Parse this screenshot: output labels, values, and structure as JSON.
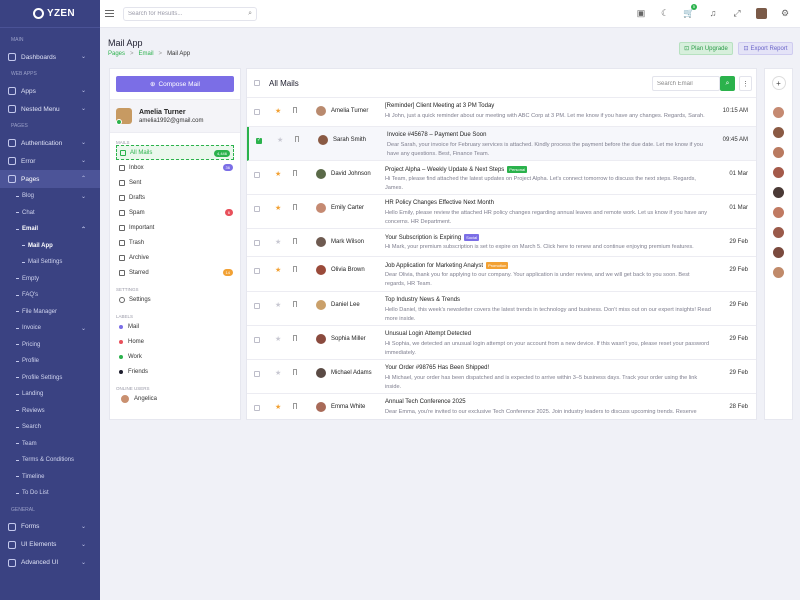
{
  "brand": {
    "name": "YZEN"
  },
  "sidebar": {
    "sections": {
      "main": "MAIN",
      "webapps": "WEB APPS",
      "pages": "PAGES",
      "general": "GENERAL"
    },
    "items": {
      "dashboards": "Dashboards",
      "apps": "Apps",
      "nested_menu": "Nested Menu",
      "authentication": "Authentication",
      "error": "Error",
      "pages": "Pages",
      "blog": "Blog",
      "chat": "Chat",
      "email": "Email",
      "mail_app": "Mail App",
      "mail_settings": "Mail Settings",
      "empty": "Empty",
      "faqs": "FAQ's",
      "file_manager": "File Manager",
      "invoice": "Invoice",
      "pricing": "Pricing",
      "profile": "Profile",
      "profile_settings": "Profile Settings",
      "landing": "Landing",
      "reviews": "Reviews",
      "search": "Search",
      "team": "Team",
      "terms": "Terms & Conditions",
      "timeline": "Timeline",
      "todo": "To Do List",
      "forms": "Forms",
      "ui_elements": "UI Elements",
      "advanced_ui": "Advanced UI"
    }
  },
  "topbar": {
    "search_placeholder": "Search for Results...",
    "cart_count": "5"
  },
  "page": {
    "title": "Mail App",
    "breadcrumb": [
      "Pages",
      "Email",
      "Mail App"
    ],
    "plan_button": "Plan Upgrade",
    "export_button": "Export Report"
  },
  "mail_panel": {
    "compose": "Compose Mail",
    "user": {
      "name": "Amelia Turner",
      "email": "amelia1992@gmail.com"
    },
    "sections": {
      "mails": "MAILS",
      "settings": "SETTINGS",
      "labels": "LABELS",
      "online": "ONLINE USERS"
    },
    "folders": [
      {
        "label": "All Mails",
        "badge": "4,446",
        "badge_color": "#2bb24c"
      },
      {
        "label": "Inbox",
        "badge": "36",
        "badge_color": "#7b6ee6"
      },
      {
        "label": "Sent",
        "badge": "",
        "badge_color": ""
      },
      {
        "label": "Drafts",
        "badge": "",
        "badge_color": ""
      },
      {
        "label": "Spam",
        "badge": "6",
        "badge_color": "#e8505b"
      },
      {
        "label": "Important",
        "badge": "",
        "badge_color": ""
      },
      {
        "label": "Trash",
        "badge": "",
        "badge_color": ""
      },
      {
        "label": "Archive",
        "badge": "",
        "badge_color": ""
      },
      {
        "label": "Starred",
        "badge": "14",
        "badge_color": "#f2a134"
      }
    ],
    "settings": "Settings",
    "labels": [
      {
        "label": "Mail",
        "color": "#7b6ee6"
      },
      {
        "label": "Home",
        "color": "#e8505b"
      },
      {
        "label": "Work",
        "color": "#2bb24c"
      },
      {
        "label": "Friends",
        "color": "#1e1e2e"
      }
    ],
    "online_users": [
      "Angelica"
    ]
  },
  "mail_list": {
    "title": "All Mails",
    "search_placeholder": "Search Email",
    "rows": [
      {
        "name": "Amelia Turner",
        "subject": "[Reminder] Client Meeting at 3 PM Today",
        "tag": "",
        "tag_color": "",
        "preview": "Hi John, just a quick reminder about our meeting with ABC Corp at 3 PM. Let me know if you have any changes. Regards, Sarah.",
        "time": "10:15 AM",
        "starred": true,
        "selected": false,
        "avatar": "#b98a6e",
        "h": 29
      },
      {
        "name": "Sarah Smith",
        "subject": "Invoice #45678 – Payment Due Soon",
        "tag": "",
        "tag_color": "",
        "preview": "Dear Sarah, your invoice for February services is attached. Kindly process the payment before the due date. Let me know if you have any questions. Best, Finance Team.",
        "time": "09:45 AM",
        "starred": false,
        "selected": true,
        "avatar": "#8a5a44",
        "h": 34
      },
      {
        "name": "David Johnson",
        "subject": "Project Alpha – Weekly Update & Next Steps",
        "tag": "Personal",
        "tag_color": "#2bb24c",
        "preview": "Hi Team, please find attached the latest updates on Project Alpha. Let's connect tomorrow to discuss the next steps. Regards, James.",
        "time": "01 Mar",
        "starred": true,
        "selected": false,
        "avatar": "#5a6a48",
        "h": 34
      },
      {
        "name": "Emily Carter",
        "subject": "HR Policy Changes Effective Next Month",
        "tag": "",
        "tag_color": "",
        "preview": "Hello Emily, please review the attached HR policy changes regarding annual leaves and remote work. Let us know if you have any concerns. HR Department.",
        "time": "01 Mar",
        "starred": true,
        "selected": false,
        "avatar": "#c58a72",
        "h": 34
      },
      {
        "name": "Mark Wilson",
        "subject": "Your Subscription is Expiring",
        "tag": "Social",
        "tag_color": "#7b6ee6",
        "preview": "Hi Mark, your premium subscription is set to expire on March 5. Click here to renew and continue enjoying premium features.",
        "time": "29 Feb",
        "starred": false,
        "selected": false,
        "avatar": "#6e5a50",
        "h": 28
      },
      {
        "name": "Olivia Brown",
        "subject": "Job Application for Marketing Analyst",
        "tag": "Promotion",
        "tag_color": "#f2a134",
        "preview": "Dear Olivia, thank you for applying to our company. Your application is under review, and we will get back to you soon. Best regards, HR Team.",
        "time": "29 Feb",
        "starred": true,
        "selected": false,
        "avatar": "#9a4a3a",
        "h": 35
      },
      {
        "name": "Daniel Lee",
        "subject": "Top Industry News & Trends",
        "tag": "",
        "tag_color": "",
        "preview": "Hello Daniel, this week's newsletter covers the latest trends in technology and business. Don't miss out on our expert insights! Read more inside.",
        "time": "29 Feb",
        "starred": false,
        "selected": false,
        "avatar": "#caa06a",
        "h": 34
      },
      {
        "name": "Sophia Miller",
        "subject": "Unusual Login Attempt Detected",
        "tag": "",
        "tag_color": "",
        "preview": "Hi Sophia, we detected an unusual login attempt on your account from a new device. If this wasn't you, please reset your password immediately.",
        "time": "29 Feb",
        "starred": false,
        "selected": false,
        "avatar": "#8a4a3e",
        "h": 34
      },
      {
        "name": "Michael Adams",
        "subject": "Your Order #98765 Has Been Shipped!",
        "tag": "",
        "tag_color": "",
        "preview": "Hi Michael, your order has been dispatched and is expected to arrive within 3–5 business days. Track your order using the link inside.",
        "time": "29 Feb",
        "starred": false,
        "selected": false,
        "avatar": "#5a4a44",
        "h": 34
      },
      {
        "name": "Emma White",
        "subject": "Annual Tech Conference 2025",
        "tag": "",
        "tag_color": "",
        "preview": "Dear Emma, you're invited to our exclusive Tech Conference 2025. Join industry leaders to discuss upcoming trends. Reserve",
        "time": "28 Feb",
        "starred": true,
        "selected": false,
        "avatar": "#a86a58",
        "h": 34
      }
    ]
  },
  "contacts": {
    "avatars": [
      "#c58a72",
      "#8a5a44",
      "#b97a60",
      "#a45a4a",
      "#4a3a36",
      "#c07a62",
      "#9a5a4a",
      "#7a4a3e",
      "#c08a6a"
    ]
  }
}
